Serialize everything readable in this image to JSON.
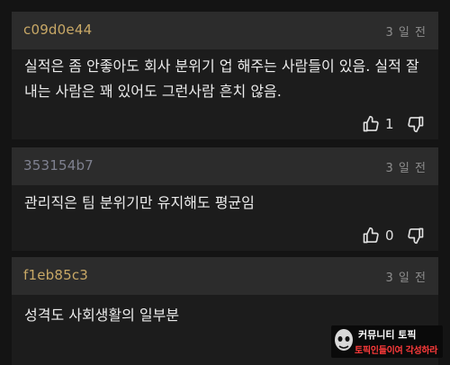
{
  "comments": [
    {
      "username": "c09d0e44",
      "username_color": "#c8a866",
      "timestamp": "3 일 전",
      "text": "실적은 좀 안좋아도 회사 분위기 업 해주는 사람들이 있음. 실적 잘\n내는 사람은 꽤 있어도 그런사람 흔치 않음.",
      "likes": "1",
      "has_actions": true
    },
    {
      "username": "353154b7",
      "username_color": "#7f8190",
      "timestamp": "3 일 전",
      "text": "관리직은 팀 분위기만 유지해도 평균임",
      "likes": "0",
      "has_actions": true
    },
    {
      "username": "f1eb85c3",
      "username_color": "#c8a866",
      "timestamp": "3 일 전",
      "text": "성격도 사회생활의 일부분",
      "has_actions": false
    }
  ],
  "icons": {
    "like": "thumbs-up-icon",
    "dislike": "thumbs-down-icon"
  },
  "watermark": {
    "line1": "커뮤니티 토픽",
    "line2": "토픽인들이여 각성하라"
  }
}
